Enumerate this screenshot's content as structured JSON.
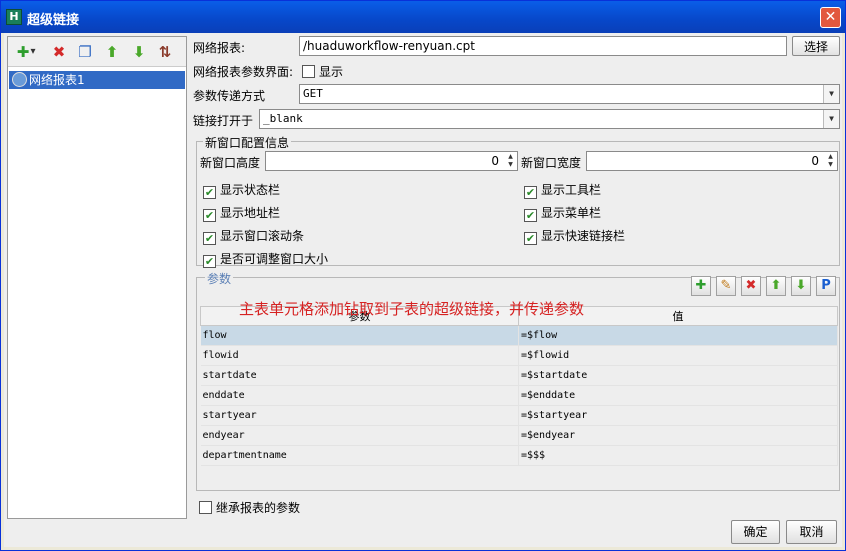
{
  "window": {
    "title": "超级链接",
    "app_icon": "app-logo-icon",
    "close_label": "✕"
  },
  "left": {
    "toolbar": [
      {
        "name": "add-icon",
        "glyph": "✚",
        "color": "#2e9e2e"
      },
      {
        "name": "dropdown-caret-icon",
        "glyph": "▾",
        "color": "#333333"
      },
      {
        "name": "delete-icon",
        "glyph": "✖",
        "color": "#d42a2a"
      },
      {
        "name": "copy-icon",
        "glyph": "❐",
        "color": "#3a6fc4"
      },
      {
        "name": "move-up-icon",
        "glyph": "⬆",
        "color": "#4aa82a"
      },
      {
        "name": "move-down-icon",
        "glyph": "⬇",
        "color": "#4aa82a"
      },
      {
        "name": "sort-icon",
        "glyph": "⇅",
        "color": "#8a3a2a"
      }
    ],
    "tree_item": "网络报表1"
  },
  "form": {
    "report_label": "网络报表:",
    "report_value": "/huaduworkflow-renyuan.cpt",
    "choose_label": "选择",
    "param_ui_label": "网络报表参数界面:",
    "param_ui_checkbox": "显示",
    "method_label": "参数传递方式",
    "method_value": "GET",
    "target_label": "链接打开于",
    "target_value": "_blank"
  },
  "new_window": {
    "title": "新窗口配置信息",
    "height_label": "新窗口高度",
    "height_value": "0",
    "width_label": "新窗口宽度",
    "width_value": "0",
    "options_left": [
      {
        "label": "显示状态栏",
        "checked": true
      },
      {
        "label": "显示地址栏",
        "checked": true
      },
      {
        "label": "显示窗口滚动条",
        "checked": true
      },
      {
        "label": "是否可调整窗口大小",
        "checked": true
      }
    ],
    "options_right": [
      {
        "label": "显示工具栏",
        "checked": true
      },
      {
        "label": "显示菜单栏",
        "checked": true
      },
      {
        "label": "显示快速链接栏",
        "checked": true
      }
    ]
  },
  "params": {
    "title": "参数",
    "annotation": "主表单元格添加钻取到子表的超级链接，并传递参数",
    "toolbar": [
      {
        "name": "add-param-icon",
        "glyph": "✚",
        "color": "#2e9e2e"
      },
      {
        "name": "edit-param-icon",
        "glyph": "✎",
        "color": "#c07a1a"
      },
      {
        "name": "delete-param-icon",
        "glyph": "✖",
        "color": "#d42a2a"
      },
      {
        "name": "move-up-param-icon",
        "glyph": "⬆",
        "color": "#4aa82a"
      },
      {
        "name": "move-down-param-icon",
        "glyph": "⬇",
        "color": "#4aa82a"
      },
      {
        "name": "param-p-icon",
        "glyph": "P",
        "color": "#1a5fd0"
      }
    ],
    "columns": [
      "参数",
      "值"
    ],
    "rows": [
      {
        "name": "flow",
        "value": "=$flow"
      },
      {
        "name": "flowid",
        "value": "=$flowid"
      },
      {
        "name": "startdate",
        "value": "=$startdate"
      },
      {
        "name": "enddate",
        "value": "=$enddate"
      },
      {
        "name": "startyear",
        "value": "=$startyear"
      },
      {
        "name": "endyear",
        "value": "=$endyear"
      },
      {
        "name": "departmentname",
        "value": "=$$$"
      }
    ],
    "inherit_label": "继承报表的参数"
  },
  "footer": {
    "ok_label": "确定",
    "cancel_label": "取消"
  }
}
